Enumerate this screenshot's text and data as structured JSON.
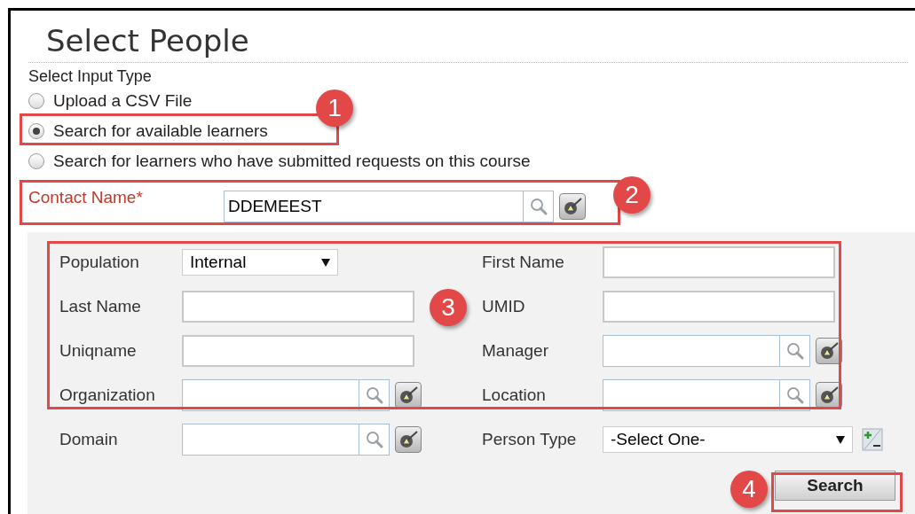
{
  "title": "Select People",
  "input_type": {
    "label": "Select Input Type",
    "options": [
      {
        "label": "Upload a CSV File",
        "selected": false
      },
      {
        "label": "Search for available learners",
        "selected": true
      },
      {
        "label": "Search for learners who have submitted requests on this course",
        "selected": false
      }
    ]
  },
  "contact": {
    "label": "Contact Name*",
    "value": "DDEMEEST"
  },
  "rows": [
    {
      "left": {
        "label": "Population",
        "kind": "select",
        "value": "Internal"
      },
      "right": {
        "label": "First Name",
        "kind": "text"
      }
    },
    {
      "left": {
        "label": "Last Name",
        "kind": "text"
      },
      "right": {
        "label": "UMID",
        "kind": "text"
      }
    },
    {
      "left": {
        "label": "Uniqname",
        "kind": "text"
      },
      "right": {
        "label": "Manager",
        "kind": "lookup"
      }
    },
    {
      "left": {
        "label": "Organization",
        "kind": "lookup"
      },
      "right": {
        "label": "Location",
        "kind": "lookup"
      }
    },
    {
      "left": {
        "label": "Domain",
        "kind": "lookup"
      },
      "right": {
        "label": "Person Type",
        "kind": "select_add",
        "value": "-Select One-"
      }
    }
  ],
  "search_button": "Search",
  "callouts": [
    "1",
    "2",
    "3",
    "4"
  ]
}
